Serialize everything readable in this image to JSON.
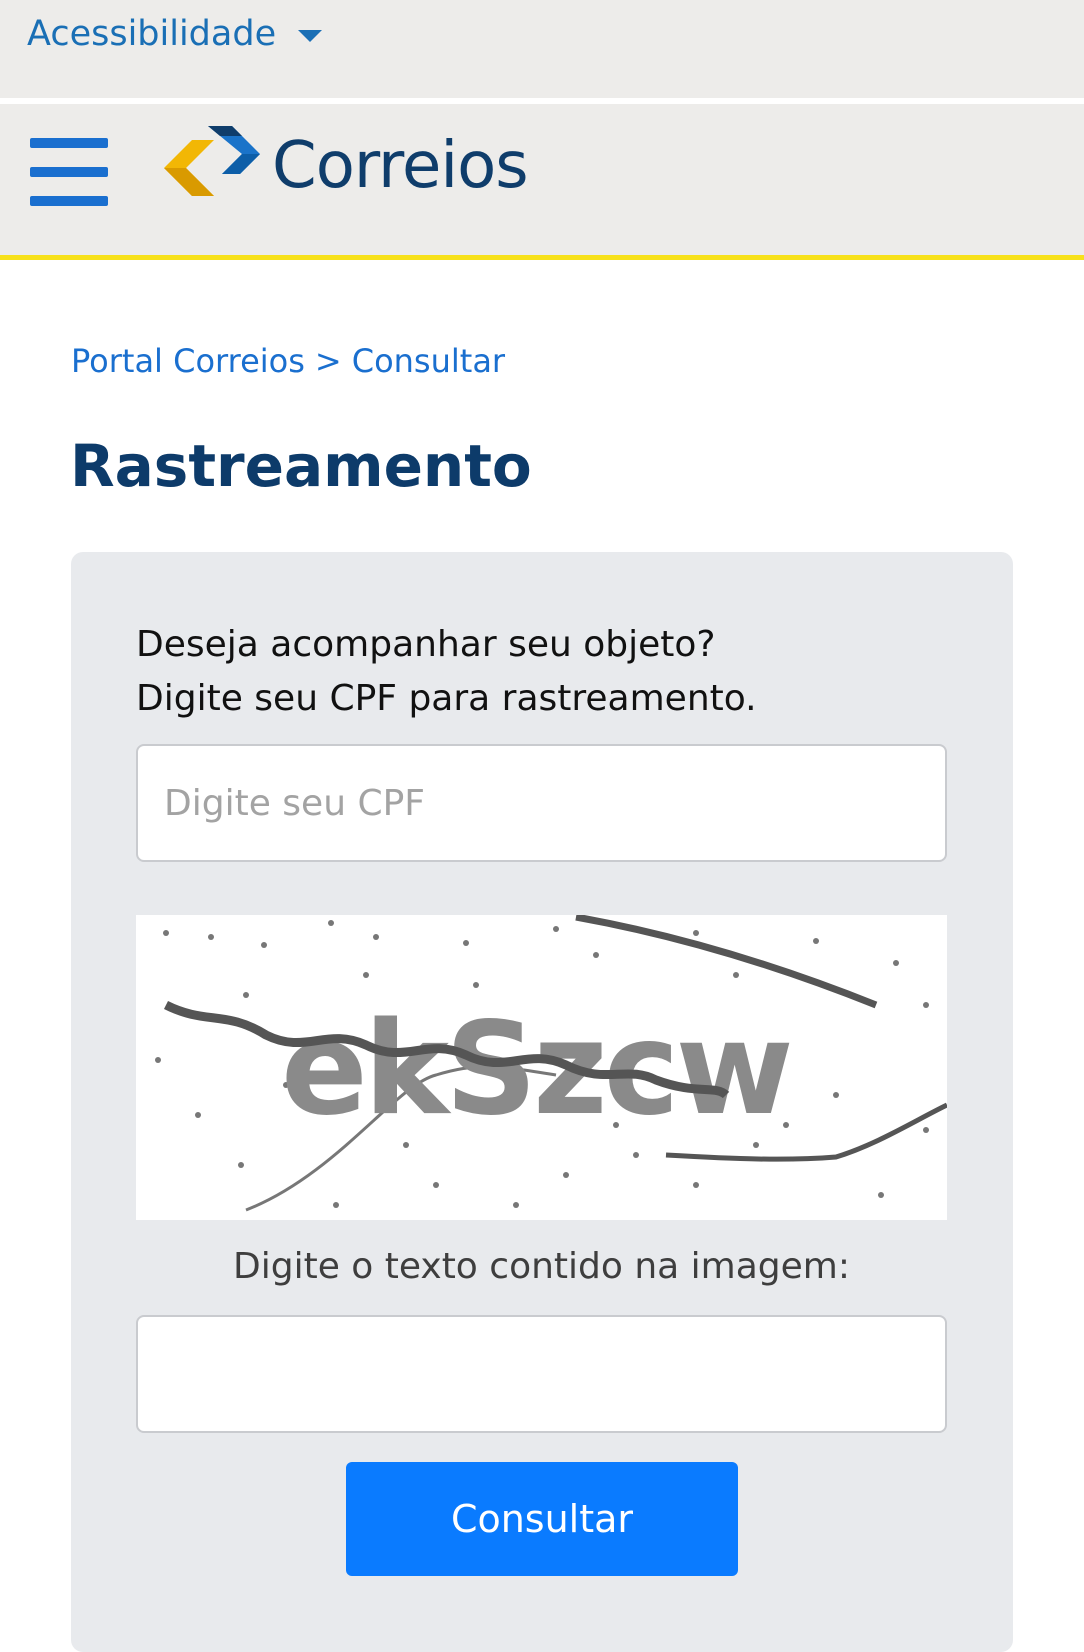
{
  "accessibility": {
    "label": "Acessibilidade",
    "icon": "caret-down-icon"
  },
  "header": {
    "menu_icon": "hamburger-menu-icon",
    "logo_text": "Correios",
    "accent_color": "#f7e11a"
  },
  "breadcrumb": {
    "home": "Portal Correios",
    "separator": ">",
    "current": "Consultar"
  },
  "page": {
    "title": "Rastreamento"
  },
  "form": {
    "intro_line1": "Deseja acompanhar seu objeto?",
    "intro_line2": "Digite seu CPF para rastreamento.",
    "cpf_placeholder": "Digite seu CPF",
    "captcha_text": "ekSzcw",
    "captcha_label": "Digite o texto contido na imagem:",
    "captcha_value": "",
    "submit_label": "Consultar",
    "submit_color": "#0a7bff"
  }
}
